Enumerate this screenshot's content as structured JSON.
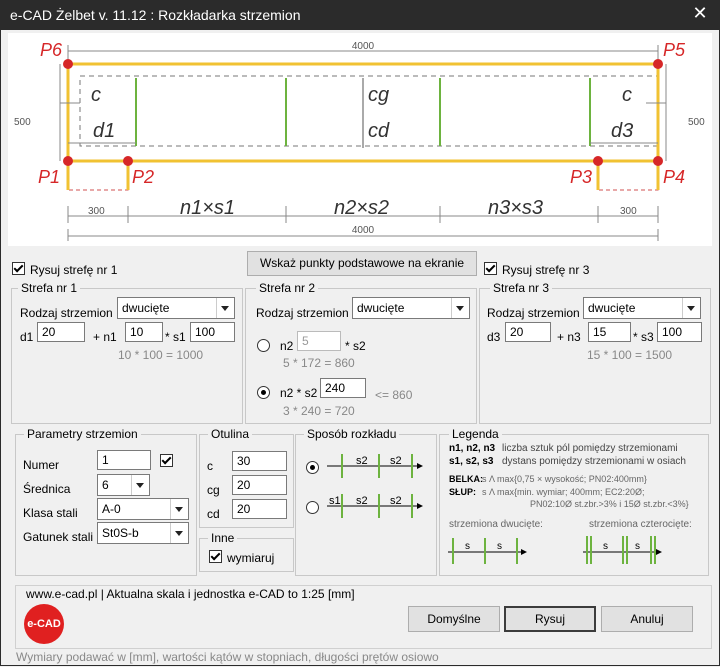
{
  "window": {
    "title": "e-CAD Żelbet v. 11.12 : Rozkładarka strzemion",
    "close_glyph": "✕"
  },
  "drawing": {
    "dim_top": "4000",
    "dim_bottom": "4000",
    "height_left": "500",
    "height_right": "500",
    "p1": "P1",
    "p2": "P2",
    "p3": "P3",
    "p4": "P4",
    "p5": "P5",
    "p6": "P6",
    "c_left": "c",
    "c_right": "c",
    "cg": "cg",
    "cd": "cd",
    "d1": "d1",
    "d3": "d3",
    "n1s1": "n1×s1",
    "n2s2": "n2×s2",
    "n3s3": "n3×s3",
    "dim_300_left": "300",
    "dim_300_right": "300"
  },
  "controls": {
    "rysuj1": "Rysuj strefę nr 1",
    "rysuj3": "Rysuj strefę nr 3",
    "wskaz_button": "Wskaż punkty podstawowe na ekranie"
  },
  "strefa1": {
    "title": "Strefa nr 1",
    "rodzaj_label": "Rodzaj strzemion",
    "rodzaj": "dwucięte",
    "d1_label": "d1",
    "d1": "20",
    "n1_label": "+ n1",
    "n1": "10",
    "s1_label": "* s1",
    "s1": "100",
    "formula": "10 * 100 = 1000"
  },
  "strefa2": {
    "title": "Strefa nr 2",
    "rodzaj_label": "Rodzaj strzemion",
    "rodzaj": "dwucięte",
    "opt1_n2": "n2",
    "opt1_n2_val": "5",
    "opt1_s2": "* s2",
    "formula1": "5 * 172 = 860",
    "opt2_label": "n2 * s2",
    "opt2_val": "240",
    "opt2_le": "<= 860",
    "formula2": "3 * 240 = 720"
  },
  "strefa3": {
    "title": "Strefa nr 3",
    "rodzaj_label": "Rodzaj strzemion",
    "rodzaj": "dwucięte",
    "d3_label": "d3",
    "d3": "20",
    "n3_label": "+ n3",
    "n3": "15",
    "s3_label": "* s3",
    "s3": "100",
    "formula": "15 * 100 = 1500"
  },
  "parametry": {
    "title": "Parametry strzemion",
    "numer_label": "Numer",
    "numer": "1",
    "srednica_label": "Średnica",
    "srednica": "6",
    "klasa_label": "Klasa stali",
    "klasa": "A-0",
    "gatunek_label": "Gatunek stali",
    "gatunek": "St0S-b"
  },
  "otulina": {
    "title": "Otulina",
    "c_label": "c",
    "c": "30",
    "cg_label": "cg",
    "cg": "20",
    "cd_label": "cd",
    "cd": "20"
  },
  "inne": {
    "title": "Inne",
    "wymiaruj": "wymiaruj"
  },
  "sposob": {
    "title": "Sposób rozkładu",
    "s2": "s2",
    "s1": "s1"
  },
  "legenda": {
    "title": "Legenda",
    "l1a": "n1, n2, n3",
    "l1b": "liczba sztuk pól pomiędzy strzemionami",
    "l2a": "s1, s2, s3",
    "l2b": "dystans pomiędzy strzemionami w osiach",
    "belka_a": "BELKA:",
    "belka_b": "s Λ max{0,75 × wysokość; PN02:400mm}",
    "slup_a": "SŁUP:",
    "slup_b": "s Λ max{min. wymiar; 400mm; EC2:20Ø;",
    "slup_c": "PN02:10Ø st.zbr.>3% i 15Ø st.zbr.<3%}",
    "dwuciete": "strzemiona dwucięte:",
    "czterociete": "strzemiona czterocięte:",
    "s": "s"
  },
  "footer": {
    "info": "www.e-cad.pl | Aktualna skala i jednostka e-CAD to 1:25 [mm]",
    "logo": "e-CAD",
    "domyslne": "Domyślne",
    "rysuj": "Rysuj",
    "anuluj": "Anuluj",
    "status": "Wymiary podawać w [mm], wartości kątów w stopniach, długości prętów osiowo"
  }
}
